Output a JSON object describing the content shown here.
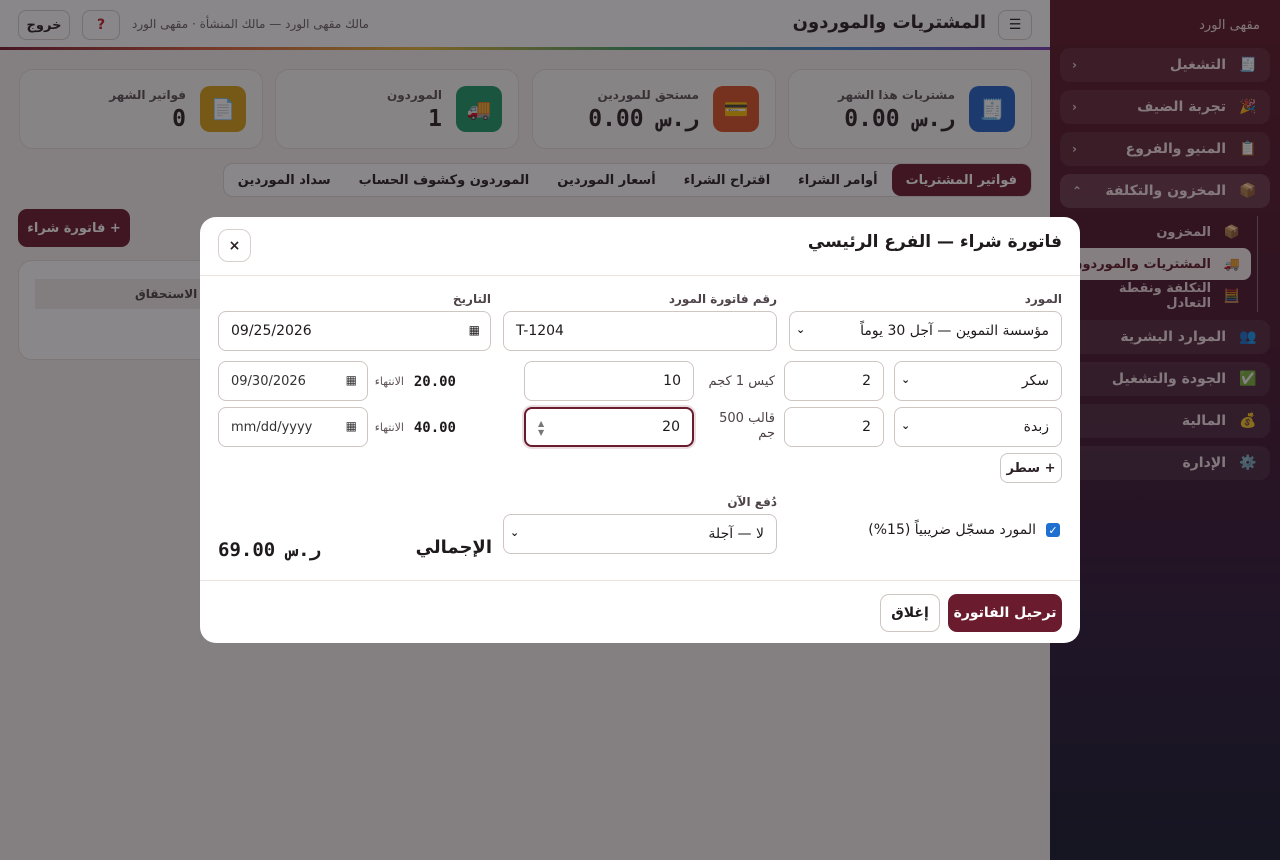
{
  "sidebar": {
    "brand": "مقهى الورد",
    "items": [
      {
        "label": "التشغيل",
        "icon": "🧾",
        "chevron": "‹"
      },
      {
        "label": "تجربة الضيف",
        "icon": "🎉",
        "chevron": "‹"
      },
      {
        "label": "المنيو والفروع",
        "icon": "📋",
        "chevron": "‹"
      },
      {
        "label": "المخزون والتكلفة",
        "icon": "📦",
        "chevron": "⌃"
      },
      {
        "label": "الموارد البشرية",
        "icon": "👥",
        "chevron": ""
      },
      {
        "label": "الجودة والتشغيل",
        "icon": "✅",
        "chevron": ""
      },
      {
        "label": "المالية",
        "icon": "💰",
        "chevron": ""
      },
      {
        "label": "الإدارة",
        "icon": "⚙️",
        "chevron": ""
      }
    ],
    "sub_items": [
      {
        "label": "المخزون",
        "icon": "📦"
      },
      {
        "label": "المشتريات والموردون",
        "icon": "🚚"
      },
      {
        "label": "التكلفة ونقطة التعادل",
        "icon": "🧮"
      }
    ]
  },
  "topbar": {
    "menu_icon": "☰",
    "title": "المشتريات والموردون",
    "user": "مالك مقهى الورد — مالك المنشأة · مقهى الورد",
    "help_icon": "?",
    "logout": "خروج"
  },
  "stats": [
    {
      "label": "مشتريات هذا الشهر",
      "value": "ر.س 0.00",
      "icon": "🧾",
      "color": "#2565c9"
    },
    {
      "label": "مستحق للموردين",
      "value": "ر.س 0.00",
      "icon": "💳",
      "color": "#d9532b"
    },
    {
      "label": "الموردون",
      "value": "1",
      "icon": "🚚",
      "color": "#1f9a6a"
    },
    {
      "label": "فواتير الشهر",
      "value": "0",
      "icon": "📄",
      "color": "#d9a11a"
    }
  ],
  "tabs": [
    "فواتير المشتريات",
    "أوامر الشراء",
    "اقتراح الشراء",
    "أسعار الموردين",
    "الموردون وكشوف الحساب",
    "سداد الموردين"
  ],
  "new_invoice_button": "+ فاتورة شراء",
  "table_header_partial": "ع / الاستحقاق",
  "modal": {
    "title": "فاتورة شراء — الفرع الرئيسي",
    "close_icon": "×",
    "supplier_label": "المورد",
    "supplier_value": "مؤسسة التموين — آجل 30 يوماً",
    "invoice_no_label": "رقم فاتورة المورد",
    "invoice_no_value": "T-1204",
    "date_label": "التاريخ",
    "date_value": "09/25/2026",
    "lines": [
      {
        "item": "سكر",
        "qty": "2",
        "unit": "كيس 1 كجم",
        "price": "10",
        "total": "20.00",
        "expiry_label": "الانتهاء",
        "expiry": "09/30/2026"
      },
      {
        "item": "زبدة",
        "qty": "2",
        "unit": "قالب 500 جم",
        "price": "20",
        "total": "40.00",
        "expiry_label": "الانتهاء",
        "expiry": "mm/dd/yyyy"
      }
    ],
    "add_line": "+ سطر",
    "vat_label": "المورد مسجّل ضريبياً (15%)",
    "pay_now_label": "دُفع الآن",
    "pay_now_value": "لا — آجلة",
    "total_label": "الإجمالي",
    "total_value": "ر.س 69.00",
    "post_button": "ترحيل الفاتورة",
    "close_button": "إغلاق"
  }
}
